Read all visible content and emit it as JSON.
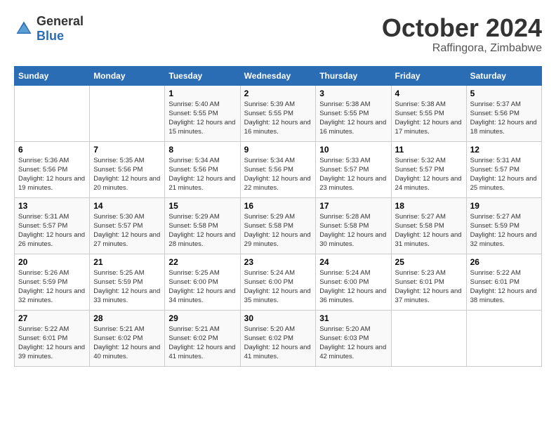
{
  "logo": {
    "general": "General",
    "blue": "Blue"
  },
  "header": {
    "month": "October 2024",
    "location": "Raffingora, Zimbabwe"
  },
  "weekdays": [
    "Sunday",
    "Monday",
    "Tuesday",
    "Wednesday",
    "Thursday",
    "Friday",
    "Saturday"
  ],
  "weeks": [
    [
      {
        "day": "",
        "info": ""
      },
      {
        "day": "",
        "info": ""
      },
      {
        "day": "1",
        "info": "Sunrise: 5:40 AM\nSunset: 5:55 PM\nDaylight: 12 hours and 15 minutes."
      },
      {
        "day": "2",
        "info": "Sunrise: 5:39 AM\nSunset: 5:55 PM\nDaylight: 12 hours and 16 minutes."
      },
      {
        "day": "3",
        "info": "Sunrise: 5:38 AM\nSunset: 5:55 PM\nDaylight: 12 hours and 16 minutes."
      },
      {
        "day": "4",
        "info": "Sunrise: 5:38 AM\nSunset: 5:55 PM\nDaylight: 12 hours and 17 minutes."
      },
      {
        "day": "5",
        "info": "Sunrise: 5:37 AM\nSunset: 5:56 PM\nDaylight: 12 hours and 18 minutes."
      }
    ],
    [
      {
        "day": "6",
        "info": "Sunrise: 5:36 AM\nSunset: 5:56 PM\nDaylight: 12 hours and 19 minutes."
      },
      {
        "day": "7",
        "info": "Sunrise: 5:35 AM\nSunset: 5:56 PM\nDaylight: 12 hours and 20 minutes."
      },
      {
        "day": "8",
        "info": "Sunrise: 5:34 AM\nSunset: 5:56 PM\nDaylight: 12 hours and 21 minutes."
      },
      {
        "day": "9",
        "info": "Sunrise: 5:34 AM\nSunset: 5:56 PM\nDaylight: 12 hours and 22 minutes."
      },
      {
        "day": "10",
        "info": "Sunrise: 5:33 AM\nSunset: 5:57 PM\nDaylight: 12 hours and 23 minutes."
      },
      {
        "day": "11",
        "info": "Sunrise: 5:32 AM\nSunset: 5:57 PM\nDaylight: 12 hours and 24 minutes."
      },
      {
        "day": "12",
        "info": "Sunrise: 5:31 AM\nSunset: 5:57 PM\nDaylight: 12 hours and 25 minutes."
      }
    ],
    [
      {
        "day": "13",
        "info": "Sunrise: 5:31 AM\nSunset: 5:57 PM\nDaylight: 12 hours and 26 minutes."
      },
      {
        "day": "14",
        "info": "Sunrise: 5:30 AM\nSunset: 5:57 PM\nDaylight: 12 hours and 27 minutes."
      },
      {
        "day": "15",
        "info": "Sunrise: 5:29 AM\nSunset: 5:58 PM\nDaylight: 12 hours and 28 minutes."
      },
      {
        "day": "16",
        "info": "Sunrise: 5:29 AM\nSunset: 5:58 PM\nDaylight: 12 hours and 29 minutes."
      },
      {
        "day": "17",
        "info": "Sunrise: 5:28 AM\nSunset: 5:58 PM\nDaylight: 12 hours and 30 minutes."
      },
      {
        "day": "18",
        "info": "Sunrise: 5:27 AM\nSunset: 5:58 PM\nDaylight: 12 hours and 31 minutes."
      },
      {
        "day": "19",
        "info": "Sunrise: 5:27 AM\nSunset: 5:59 PM\nDaylight: 12 hours and 32 minutes."
      }
    ],
    [
      {
        "day": "20",
        "info": "Sunrise: 5:26 AM\nSunset: 5:59 PM\nDaylight: 12 hours and 32 minutes."
      },
      {
        "day": "21",
        "info": "Sunrise: 5:25 AM\nSunset: 5:59 PM\nDaylight: 12 hours and 33 minutes."
      },
      {
        "day": "22",
        "info": "Sunrise: 5:25 AM\nSunset: 6:00 PM\nDaylight: 12 hours and 34 minutes."
      },
      {
        "day": "23",
        "info": "Sunrise: 5:24 AM\nSunset: 6:00 PM\nDaylight: 12 hours and 35 minutes."
      },
      {
        "day": "24",
        "info": "Sunrise: 5:24 AM\nSunset: 6:00 PM\nDaylight: 12 hours and 36 minutes."
      },
      {
        "day": "25",
        "info": "Sunrise: 5:23 AM\nSunset: 6:01 PM\nDaylight: 12 hours and 37 minutes."
      },
      {
        "day": "26",
        "info": "Sunrise: 5:22 AM\nSunset: 6:01 PM\nDaylight: 12 hours and 38 minutes."
      }
    ],
    [
      {
        "day": "27",
        "info": "Sunrise: 5:22 AM\nSunset: 6:01 PM\nDaylight: 12 hours and 39 minutes."
      },
      {
        "day": "28",
        "info": "Sunrise: 5:21 AM\nSunset: 6:02 PM\nDaylight: 12 hours and 40 minutes."
      },
      {
        "day": "29",
        "info": "Sunrise: 5:21 AM\nSunset: 6:02 PM\nDaylight: 12 hours and 41 minutes."
      },
      {
        "day": "30",
        "info": "Sunrise: 5:20 AM\nSunset: 6:02 PM\nDaylight: 12 hours and 41 minutes."
      },
      {
        "day": "31",
        "info": "Sunrise: 5:20 AM\nSunset: 6:03 PM\nDaylight: 12 hours and 42 minutes."
      },
      {
        "day": "",
        "info": ""
      },
      {
        "day": "",
        "info": ""
      }
    ]
  ]
}
